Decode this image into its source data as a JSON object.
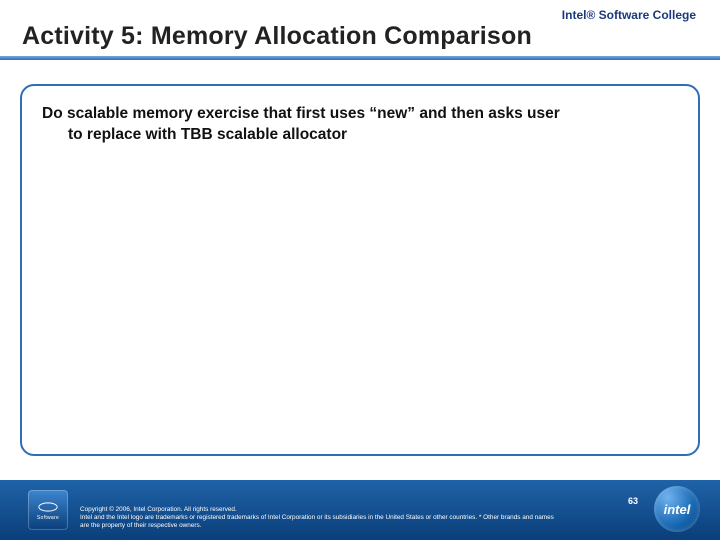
{
  "brand": "Intel® Software College",
  "title": "Activity 5: Memory Allocation Comparison",
  "body": {
    "line1": "Do scalable memory exercise that first uses “new” and then asks user",
    "line2": "to replace with TBB scalable allocator"
  },
  "footer": {
    "legal1": "Copyright © 2006, Intel Corporation. All rights reserved.",
    "legal2": "Intel and the Intel logo are trademarks or registered trademarks of Intel Corporation or its subsidiaries in the United States or other countries. * Other brands and names are the property of their respective owners.",
    "page": "63",
    "badge_label": "Software",
    "logo_text": "intel"
  }
}
